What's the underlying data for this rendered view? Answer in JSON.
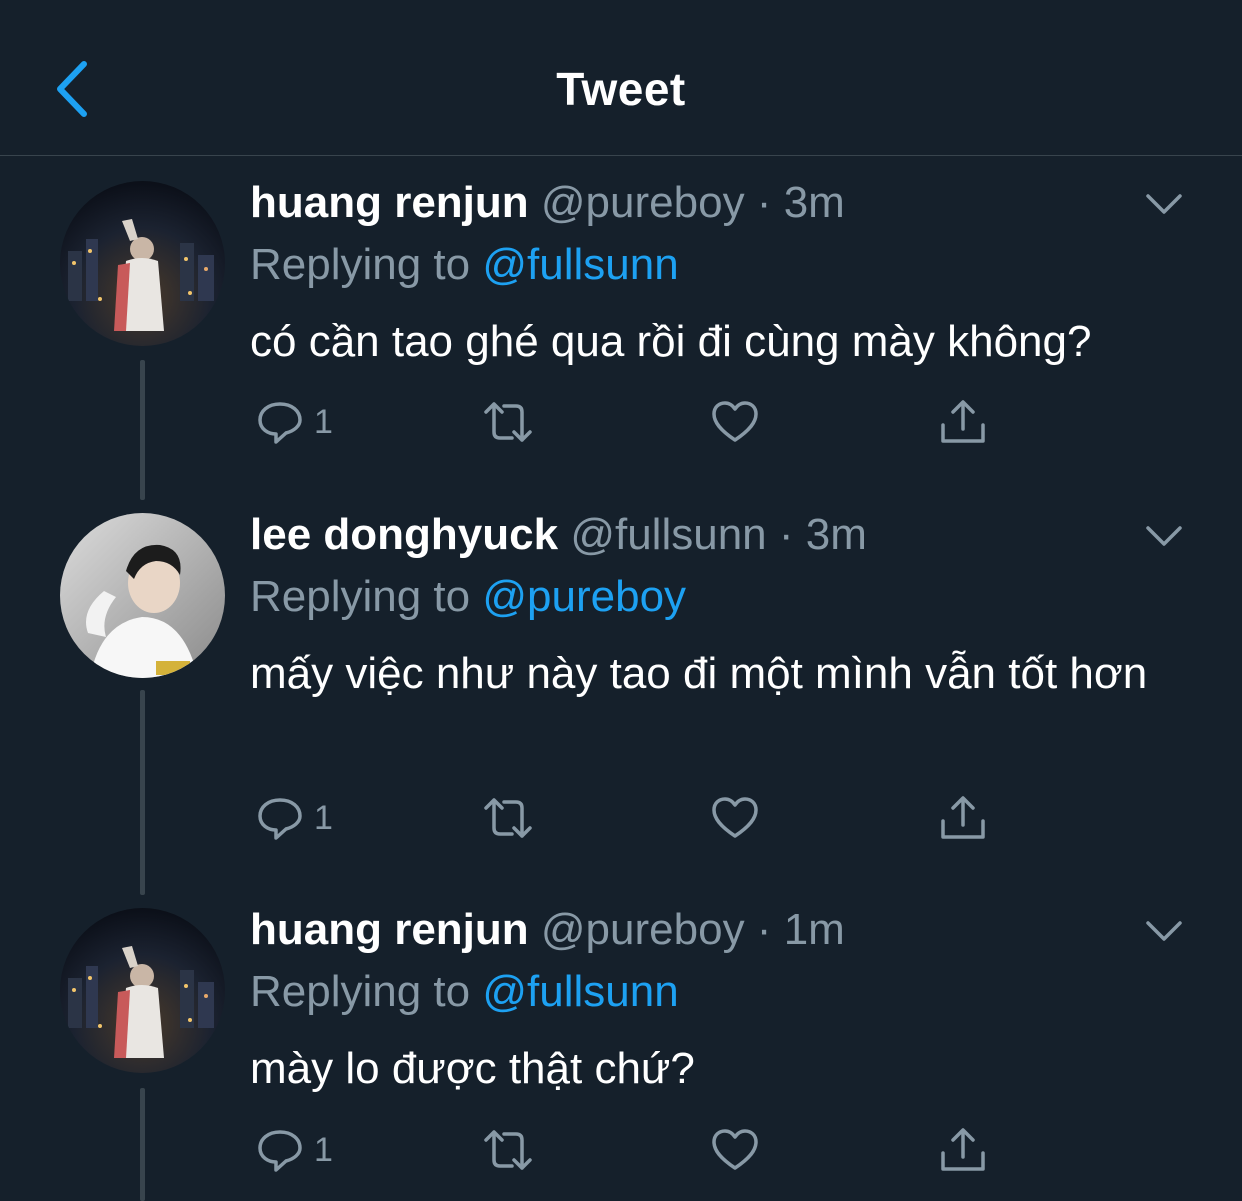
{
  "header": {
    "title": "Tweet",
    "back_icon": "chevron-left-icon"
  },
  "colors": {
    "background": "#15202b",
    "accent": "#1da1f2",
    "secondary_text": "#8899a6",
    "divider": "#38444d"
  },
  "tweets": [
    {
      "name": "huang renjun",
      "handle": "@pureboy",
      "dot": "·",
      "time": "3m",
      "reply_prefix": "Replying to",
      "reply_to": "@fullsunn",
      "text": "có cần tao ghé qua rồi đi cùng mày không?",
      "reply_count": "1"
    },
    {
      "name": "lee donghyuck",
      "handle": "@fullsunn",
      "dot": "·",
      "time": "3m",
      "reply_prefix": "Replying to",
      "reply_to": "@pureboy",
      "text": "mấy việc như này tao đi một mình vẫn tốt hơn",
      "reply_count": "1"
    },
    {
      "name": "huang renjun",
      "handle": "@pureboy",
      "dot": "·",
      "time": "1m",
      "reply_prefix": "Replying to",
      "reply_to": "@fullsunn",
      "text": "mày lo được thật chứ?",
      "reply_count": "1"
    }
  ]
}
